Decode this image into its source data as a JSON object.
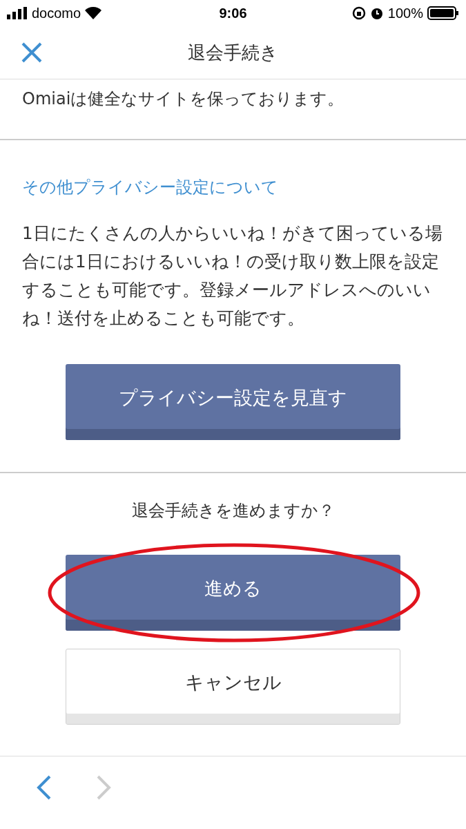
{
  "status_bar": {
    "carrier": "docomo",
    "time": "9:06",
    "battery": "100%"
  },
  "nav": {
    "title": "退会手続き"
  },
  "intro": {
    "text": "Omiaiは健全なサイトを保っております。"
  },
  "privacy": {
    "heading": "その他プライバシー設定について",
    "body": "1日にたくさんの人からいいね！がきて困っている場合には1日におけるいいね！の受け取り数上限を設定することも可能です。登録メールアドレスへのいいね！送付を止めることも可能です。",
    "button": "プライバシー設定を見直す"
  },
  "confirm": {
    "question": "退会手続きを進めますか？",
    "proceed": "進める",
    "cancel": "キャンセル",
    "annotation": {
      "kind": "ellipse",
      "color": "#e0141e"
    }
  },
  "toolbar": {
    "back_disabled": false,
    "forward_disabled": true
  }
}
